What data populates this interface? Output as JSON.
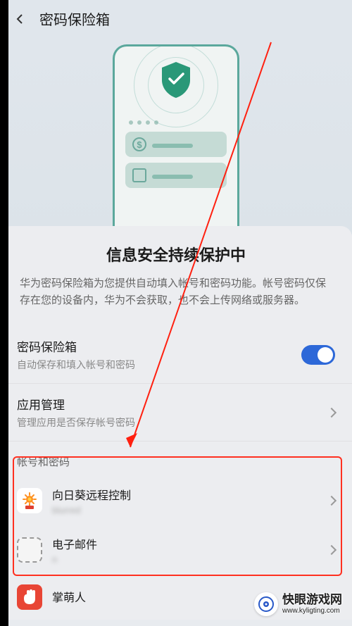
{
  "header": {
    "title": "密码保险箱"
  },
  "info": {
    "title": "信息安全持续保护中",
    "description": "华为密码保险箱为您提供自动填入帐号和密码功能。帐号密码仅保存在您的设备内，华为不会获取，也不会上传网络或服务器。"
  },
  "settings": {
    "vault": {
      "title": "密码保险箱",
      "subtitle": "自动保存和填入帐号和密码",
      "enabled": true
    },
    "apps": {
      "title": "应用管理",
      "subtitle": "管理应用是否保存帐号密码"
    }
  },
  "accounts": {
    "section_title": "帐号和密码",
    "items": [
      {
        "name": "向日葵远程控制",
        "account": "blurred"
      },
      {
        "name": "电子邮件",
        "account": "n"
      },
      {
        "name": "掌萌人",
        "account": ""
      }
    ]
  },
  "watermark": {
    "name": "快眼游戏网",
    "url": "www.kyligting.com"
  }
}
